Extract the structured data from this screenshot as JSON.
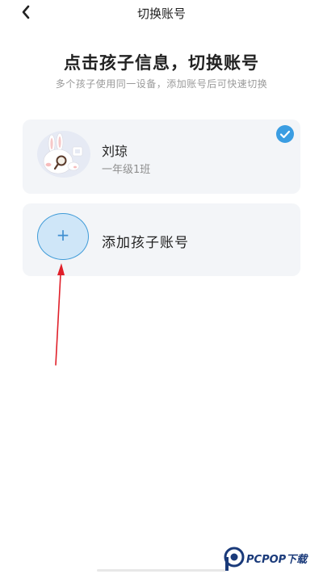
{
  "header": {
    "title": "切换账号",
    "back_icon": "chevron-left-icon"
  },
  "intro": {
    "headline": "点击孩子信息，切换账号",
    "subline": "多个孩子使用同一设备，添加账号后可快速切换"
  },
  "children": [
    {
      "name": "刘琼",
      "class": "一年级1班",
      "selected": true
    }
  ],
  "add_child": {
    "plus": "+",
    "label": "添加孩子账号"
  },
  "colors": {
    "accent": "#3a9de2",
    "card_bg": "#f3f5f8",
    "annotation_arrow": "#e0202a"
  },
  "watermark": {
    "text": "PCPOP下载"
  }
}
